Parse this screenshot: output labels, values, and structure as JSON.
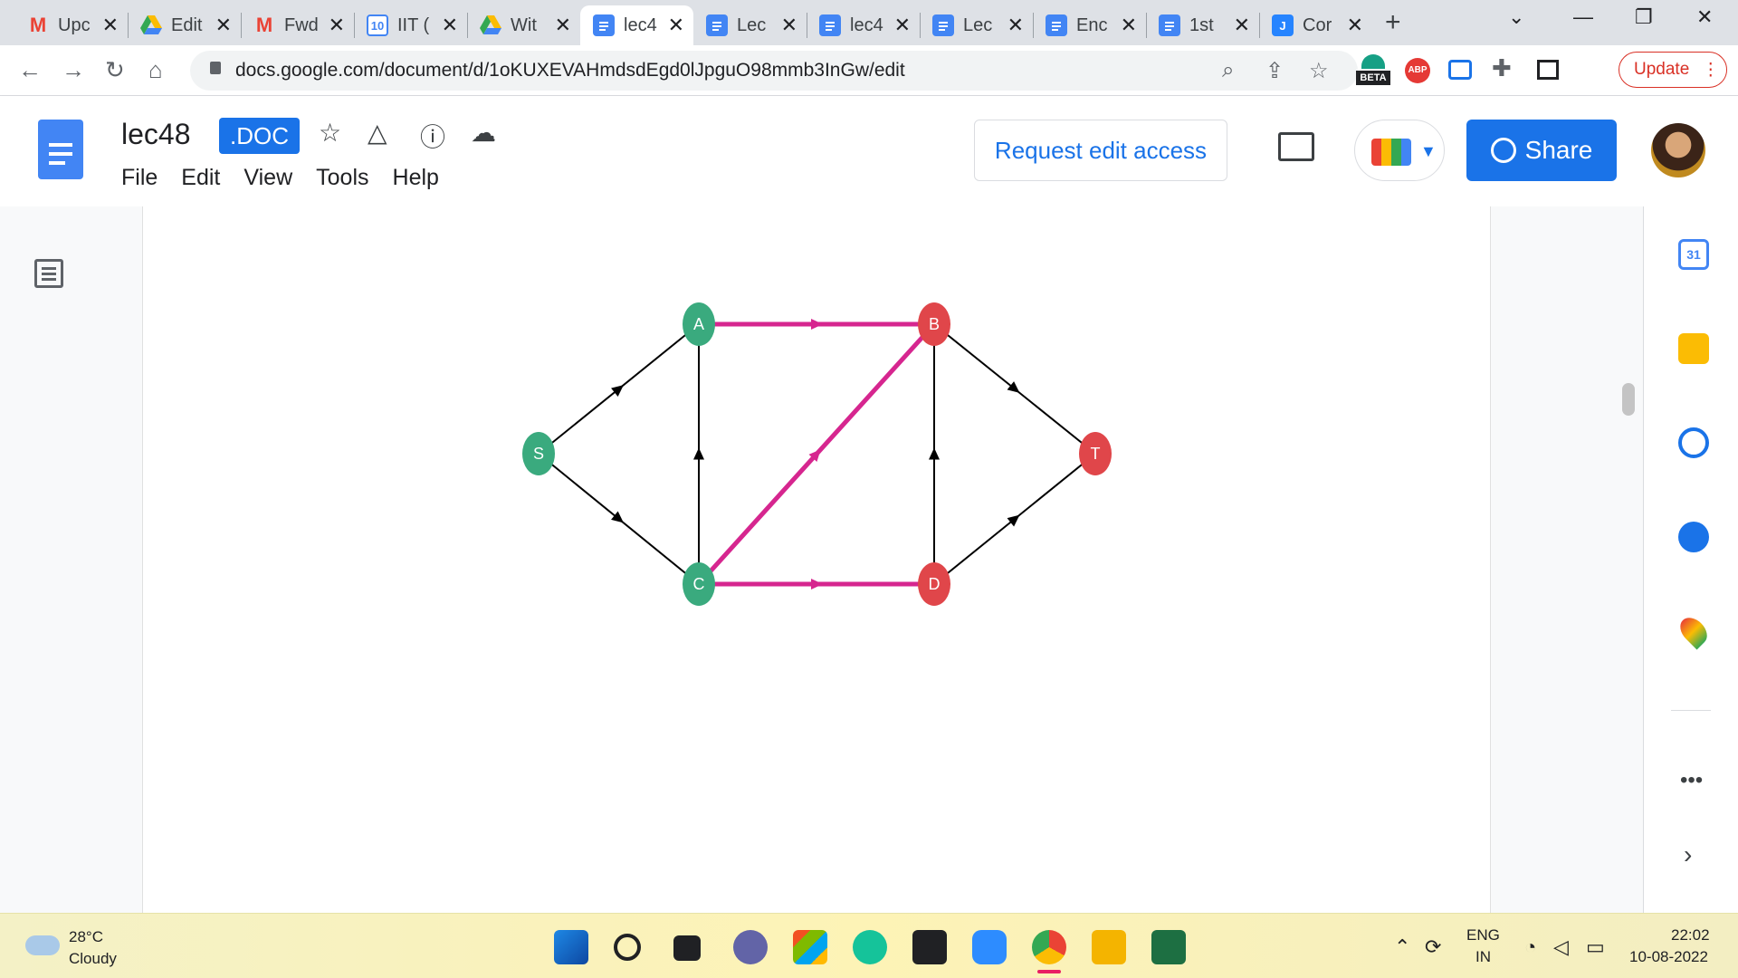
{
  "browser": {
    "tabs": [
      {
        "title": "Upc",
        "favicon": "gmail"
      },
      {
        "title": "Edit",
        "favicon": "drive"
      },
      {
        "title": "Fwd",
        "favicon": "gmail"
      },
      {
        "title": "IIT (",
        "favicon": "calendar"
      },
      {
        "title": "Wit",
        "favicon": "drive"
      },
      {
        "title": "lec4",
        "favicon": "docs"
      },
      {
        "title": "Lec",
        "favicon": "docs"
      },
      {
        "title": "lec4",
        "favicon": "docs"
      },
      {
        "title": "Lec",
        "favicon": "docs"
      },
      {
        "title": "Enc",
        "favicon": "docs"
      },
      {
        "title": "1st",
        "favicon": "docs"
      },
      {
        "title": "Cor",
        "favicon": "jira"
      }
    ],
    "active_tab_index": 5,
    "new_tab_symbol": "+",
    "url": "docs.google.com/document/d/1oKUXEVAHmdsdEgd0lJpguO98mmb3InGw/edit",
    "update_label": "Update",
    "calendar_favicon_text": "10",
    "jira_favicon_text": "J",
    "extension_beta_label": "BETA",
    "extension_abp_label": "ABP"
  },
  "docs": {
    "doc_name": "lec48",
    "doc_badge": ".DOC",
    "menu": [
      "File",
      "Edit",
      "View",
      "Tools",
      "Help"
    ],
    "request_access_label": "Request edit access",
    "share_label": "Share"
  },
  "diagram": {
    "nodes": [
      {
        "id": "S",
        "color": "#3aaa7e"
      },
      {
        "id": "A",
        "color": "#3aaa7e"
      },
      {
        "id": "C",
        "color": "#3aaa7e"
      },
      {
        "id": "B",
        "color": "#e0464a"
      },
      {
        "id": "D",
        "color": "#e0464a"
      },
      {
        "id": "T",
        "color": "#e0464a"
      }
    ],
    "edges": [
      {
        "from": "S",
        "to": "A",
        "highlight": false
      },
      {
        "from": "S",
        "to": "C",
        "highlight": false
      },
      {
        "from": "C",
        "to": "A",
        "highlight": false
      },
      {
        "from": "A",
        "to": "B",
        "highlight": true
      },
      {
        "from": "C",
        "to": "B",
        "highlight": true
      },
      {
        "from": "C",
        "to": "D",
        "highlight": true
      },
      {
        "from": "D",
        "to": "B",
        "highlight": false
      },
      {
        "from": "B",
        "to": "T",
        "highlight": false
      },
      {
        "from": "D",
        "to": "T",
        "highlight": false
      }
    ],
    "highlight_color": "#d6268f",
    "edge_color": "#000000"
  },
  "side_panel": {
    "calendar_text": "31",
    "icons": [
      "calendar-icon",
      "keep-icon",
      "tasks-icon",
      "contacts-icon",
      "maps-icon",
      "more-icon",
      "expand-icon"
    ]
  },
  "taskbar": {
    "temperature": "28°C",
    "weather": "Cloudy",
    "language_line1": "ENG",
    "language_line2": "IN",
    "time": "22:02",
    "date": "10-08-2022"
  }
}
